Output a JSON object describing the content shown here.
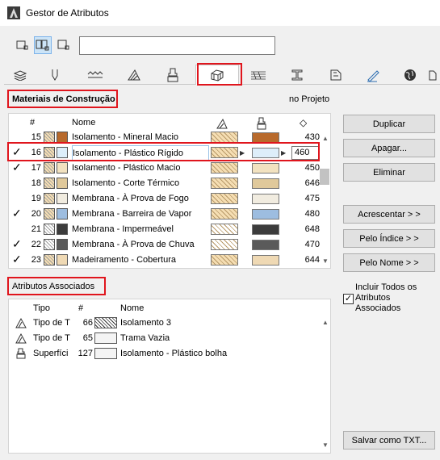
{
  "window": {
    "title": "Gestor de Atributos"
  },
  "search": {
    "value": ""
  },
  "sections": {
    "materials_title": "Materiais de Construção",
    "scope": "no Projeto",
    "associated_title": "Atributos Associados"
  },
  "materials": {
    "headers": {
      "num": "#",
      "name": "Nome",
      "diamond": "◇"
    },
    "rows": [
      {
        "check": "",
        "num": "15",
        "name": "Isolamento - Mineral Macio",
        "value": "430",
        "fill_color": "#b86a2c",
        "pattern_color": "#f5deb3"
      },
      {
        "check": "✓",
        "num": "16",
        "name": "Isolamento - Plástico Rígido",
        "value": "460",
        "fill_color": "#ddeefa",
        "pattern_color": "#f5deb3"
      },
      {
        "check": "✓",
        "num": "17",
        "name": "Isolamento - Plástico Macio",
        "value": "450",
        "fill_color": "#f2e2c0",
        "pattern_color": "#f5deb3"
      },
      {
        "check": "",
        "num": "18",
        "name": "Isolamento - Corte Térmico",
        "value": "646",
        "fill_color": "#e0c99b",
        "pattern_color": "#f5deb3"
      },
      {
        "check": "",
        "num": "19",
        "name": "Membrana - À Prova de Fogo",
        "value": "475",
        "fill_color": "#f1ece0",
        "pattern_color": "#f5deb3"
      },
      {
        "check": "✓",
        "num": "20",
        "name": "Membrana - Barreira de Vapor",
        "value": "480",
        "fill_color": "#9dbde0",
        "pattern_color": "#f5deb3"
      },
      {
        "check": "",
        "num": "21",
        "name": "Membrana - Impermeável",
        "value": "648",
        "fill_color": "#3c3c3c",
        "pattern_color": "#ffffff"
      },
      {
        "check": "✓",
        "num": "22",
        "name": "Membrana - À Prova de Chuva",
        "value": "470",
        "fill_color": "#5a5a5a",
        "pattern_color": "#ffffff"
      },
      {
        "check": "✓",
        "num": "23",
        "name": "Madeiramento - Cobertura",
        "value": "644",
        "fill_color": "#efd9b4",
        "pattern_color": "#f5deb3"
      }
    ]
  },
  "associated": {
    "headers": {
      "type": "Tipo",
      "num": "#",
      "name": "Nome"
    },
    "rows": [
      {
        "icon": "fill-type-icon",
        "type": "Tipo de T",
        "num": "66",
        "name": "Isolamento 3"
      },
      {
        "icon": "fill-type-icon",
        "type": "Tipo de T",
        "num": "65",
        "name": "Trama Vazia"
      },
      {
        "icon": "surface-brush-icon",
        "type": "Superfíci",
        "num": "127",
        "name": "Isolamento - Plástico bolha"
      }
    ]
  },
  "buttons": {
    "duplicate": "Duplicar",
    "delete": "Apagar...",
    "remove": "Eliminar",
    "add": "Acrescentar > >",
    "by_index": "Pelo Índice > >",
    "by_name": "Pelo Nome > >",
    "save_txt": "Salvar como TXT..."
  },
  "include_all": {
    "label": "Incluir Todos os Atributos Associados",
    "checked": true
  },
  "colors": {
    "selection_border": "#e0151d",
    "selected_view": "#cce4f7"
  }
}
